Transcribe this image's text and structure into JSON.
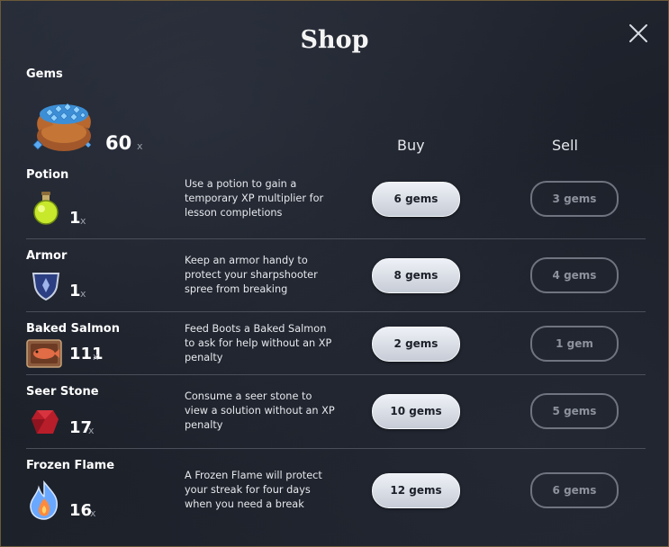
{
  "title": "Shop",
  "gems": {
    "label": "Gems",
    "count": "60",
    "x": "x"
  },
  "columns": {
    "buy": "Buy",
    "sell": "Sell"
  },
  "items": [
    {
      "name": "Potion",
      "qty": "1",
      "x": "x",
      "desc": "Use a potion to gain a temporary XP multiplier for lesson completions",
      "buy": "6 gems",
      "sell": "3 gems",
      "icon": "potion-icon"
    },
    {
      "name": "Armor",
      "qty": "1",
      "x": "x",
      "desc": "Keep an armor handy to protect your sharpshooter spree from breaking",
      "buy": "8 gems",
      "sell": "4 gems",
      "icon": "armor-shield-icon"
    },
    {
      "name": "Baked Salmon",
      "qty": "111",
      "x": "x",
      "desc": "Feed Boots a Baked Salmon to ask for help without an XP penalty",
      "buy": "2 gems",
      "sell": "1 gem",
      "icon": "baked-salmon-icon"
    },
    {
      "name": "Seer Stone",
      "qty": "17",
      "x": "x",
      "desc": "Consume a seer stone to view a solution without an XP penalty",
      "buy": "10 gems",
      "sell": "5 gems",
      "icon": "seer-stone-icon"
    },
    {
      "name": "Frozen Flame",
      "qty": "16",
      "x": "x",
      "desc": "A Frozen Flame will protect your streak for four days when you need a break",
      "buy": "12 gems",
      "sell": "6 gems",
      "icon": "frozen-flame-icon"
    }
  ],
  "colors": {
    "border": "#6b5a3a",
    "buy_button": "#dfe4ec",
    "sell_border": "#6f7480",
    "background": "#1f232c"
  }
}
